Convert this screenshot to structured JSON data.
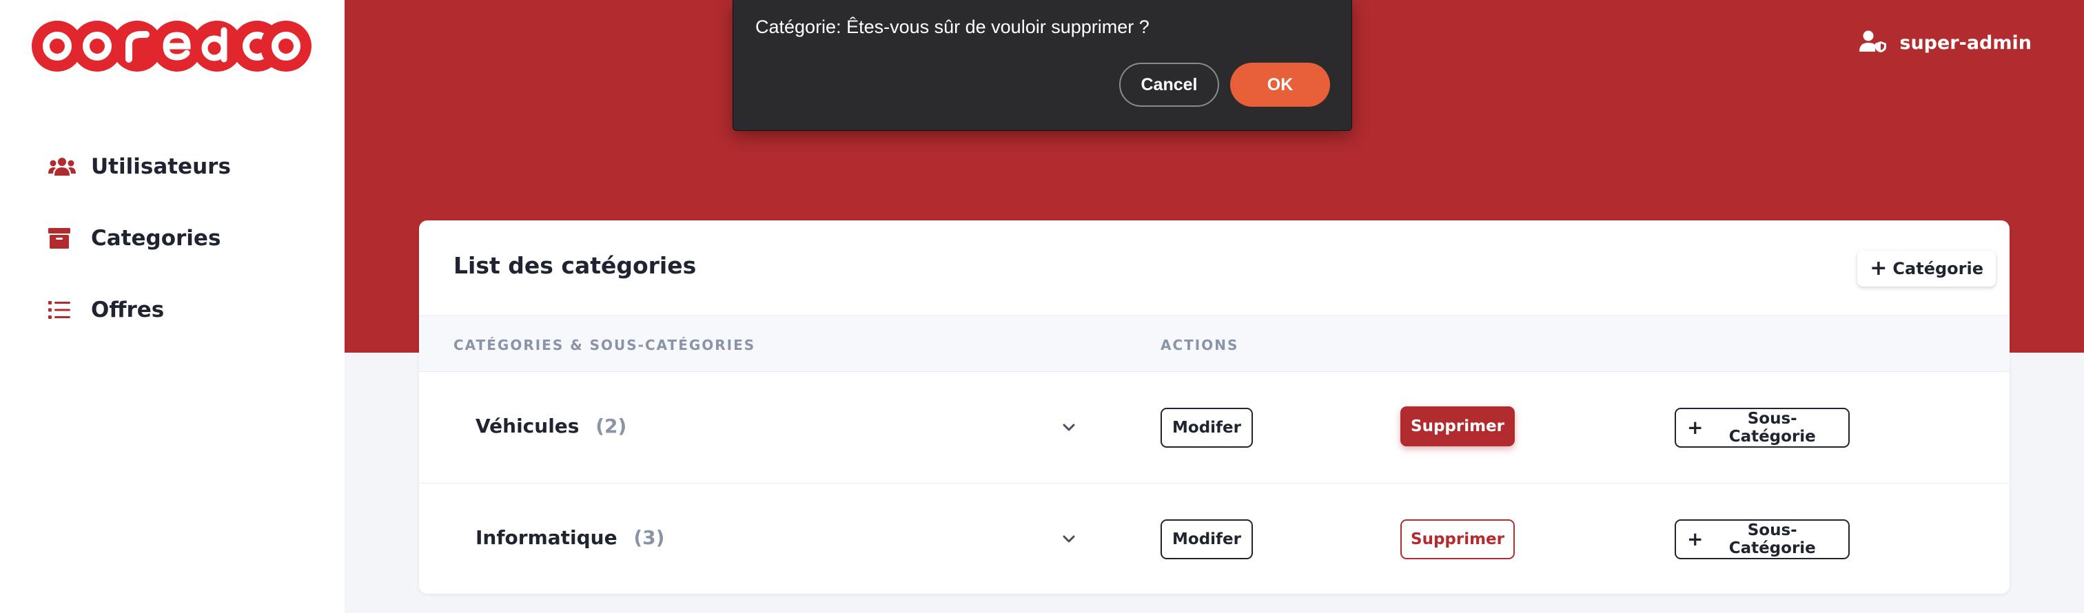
{
  "brand": {
    "logo_text": "ooredoo",
    "color": "#e2262e"
  },
  "sidebar": {
    "items": [
      {
        "label": "Utilisateurs",
        "icon": "users-icon"
      },
      {
        "label": "Categories",
        "icon": "archive-box-icon"
      },
      {
        "label": "Offres",
        "icon": "list-icon"
      }
    ]
  },
  "header": {
    "user_name": "super-admin",
    "user_icon": "user-shield-icon"
  },
  "dialog": {
    "message": "Catégorie: Êtes-vous sûr de vouloir supprimer ?",
    "cancel_label": "Cancel",
    "ok_label": "OK"
  },
  "card": {
    "title": "List des catégories",
    "add_button_label": "Catégorie",
    "columns": [
      "CATÉGORIES & SOUS-CATÉGORIES",
      "ACTIONS"
    ],
    "rows": [
      {
        "name": "Véhicules",
        "count": "(2)",
        "modify_label": "Modifer",
        "delete_label": "Supprimer",
        "delete_active": true,
        "add_sub_label": "Sous-Catégorie"
      },
      {
        "name": "Informatique",
        "count": "(3)",
        "modify_label": "Modifer",
        "delete_label": "Supprimer",
        "delete_active": false,
        "add_sub_label": "Sous-Catégorie"
      }
    ]
  },
  "colors": {
    "header_red": "#b12b2f",
    "ok_orange": "#e8603a",
    "dialog_bg": "#2b2b2d"
  }
}
